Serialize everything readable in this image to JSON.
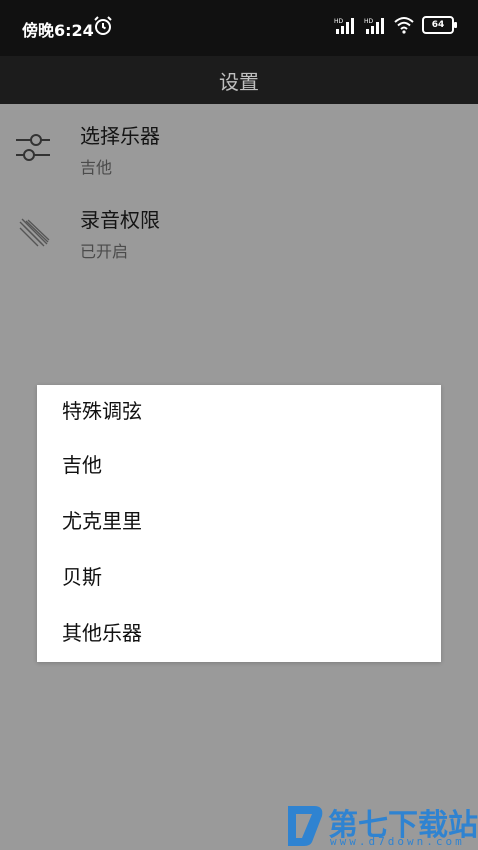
{
  "status_bar": {
    "time": "傍晚6:24",
    "battery": "64"
  },
  "header": {
    "title": "设置"
  },
  "settings": [
    {
      "title": "选择乐器",
      "subtitle": "吉他",
      "icon": "sliders-icon"
    },
    {
      "title": "录音权限",
      "subtitle": "已开启",
      "icon": "microphone-stripes-icon"
    }
  ],
  "dialog": {
    "options": [
      "特殊调弦",
      "吉他",
      "尤克里里",
      "贝斯",
      "其他乐器"
    ]
  },
  "watermark": {
    "text": "第七下载站",
    "url": "www.d7down.com"
  }
}
